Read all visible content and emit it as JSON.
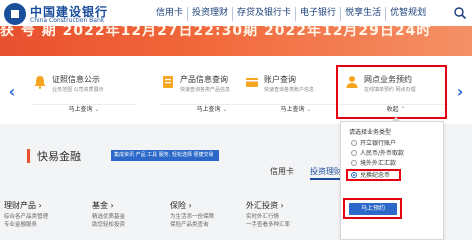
{
  "header": {
    "logo_cn": "中国建设银行",
    "logo_en": "China Construction Bank",
    "nav": [
      "信用卡",
      "投资理财",
      "存贷及银行卡",
      "电子银行",
      "悦享生活",
      "优智规划"
    ]
  },
  "banner": {
    "text": "获 号 期  2022年12月27日22:30期  2022年12月29日24时"
  },
  "services": [
    {
      "title": "证照信息公示",
      "sub": "业务范围  公司资质展示",
      "button": "马上查询"
    },
    {
      "title": "产品信息查询",
      "sub": "快速查询各类产品信息",
      "button": "马上查询"
    },
    {
      "title": "账户查询",
      "sub": "快速查询各类账户信息",
      "button": "马上查询"
    },
    {
      "title": "网点业务预约",
      "sub": "在线填单预约  网点办理",
      "button": "收起"
    }
  ],
  "quick": {
    "title": "快易金融",
    "tags": "集成资讯  产品  工具  服务, 轻松选择 便捷交易",
    "tabs": [
      "信用卡",
      "投资理财"
    ],
    "tiles": [
      {
        "title": "理财产品 ›",
        "lines": [
          "综合各产品类管理",
          "专业金融服务"
        ]
      },
      {
        "title": "基金 ›",
        "lines": [
          "精选优质基金",
          "助您轻松投资"
        ]
      },
      {
        "title": "保险 ›",
        "lines": [
          "为生活添一份保障",
          "保险产品类查询"
        ]
      },
      {
        "title": "外汇投资 ›",
        "lines": [
          "实时外汇行情",
          "一手查看多种汇率"
        ]
      }
    ]
  },
  "dropdown": {
    "title": "请选择业务类型",
    "options": [
      {
        "label": "开立银行账户",
        "selected": false
      },
      {
        "label": "人民币/外币取款",
        "selected": false
      },
      {
        "label": "境外外汇汇款",
        "selected": false
      },
      {
        "label": "兑换纪念币",
        "selected": true
      }
    ],
    "submit": "马上预约"
  },
  "colors": {
    "brand_blue": "#1a4e9b",
    "accent_orange": "#e8502e",
    "highlight_red": "#e60012",
    "button_blue": "#2b68c9"
  }
}
